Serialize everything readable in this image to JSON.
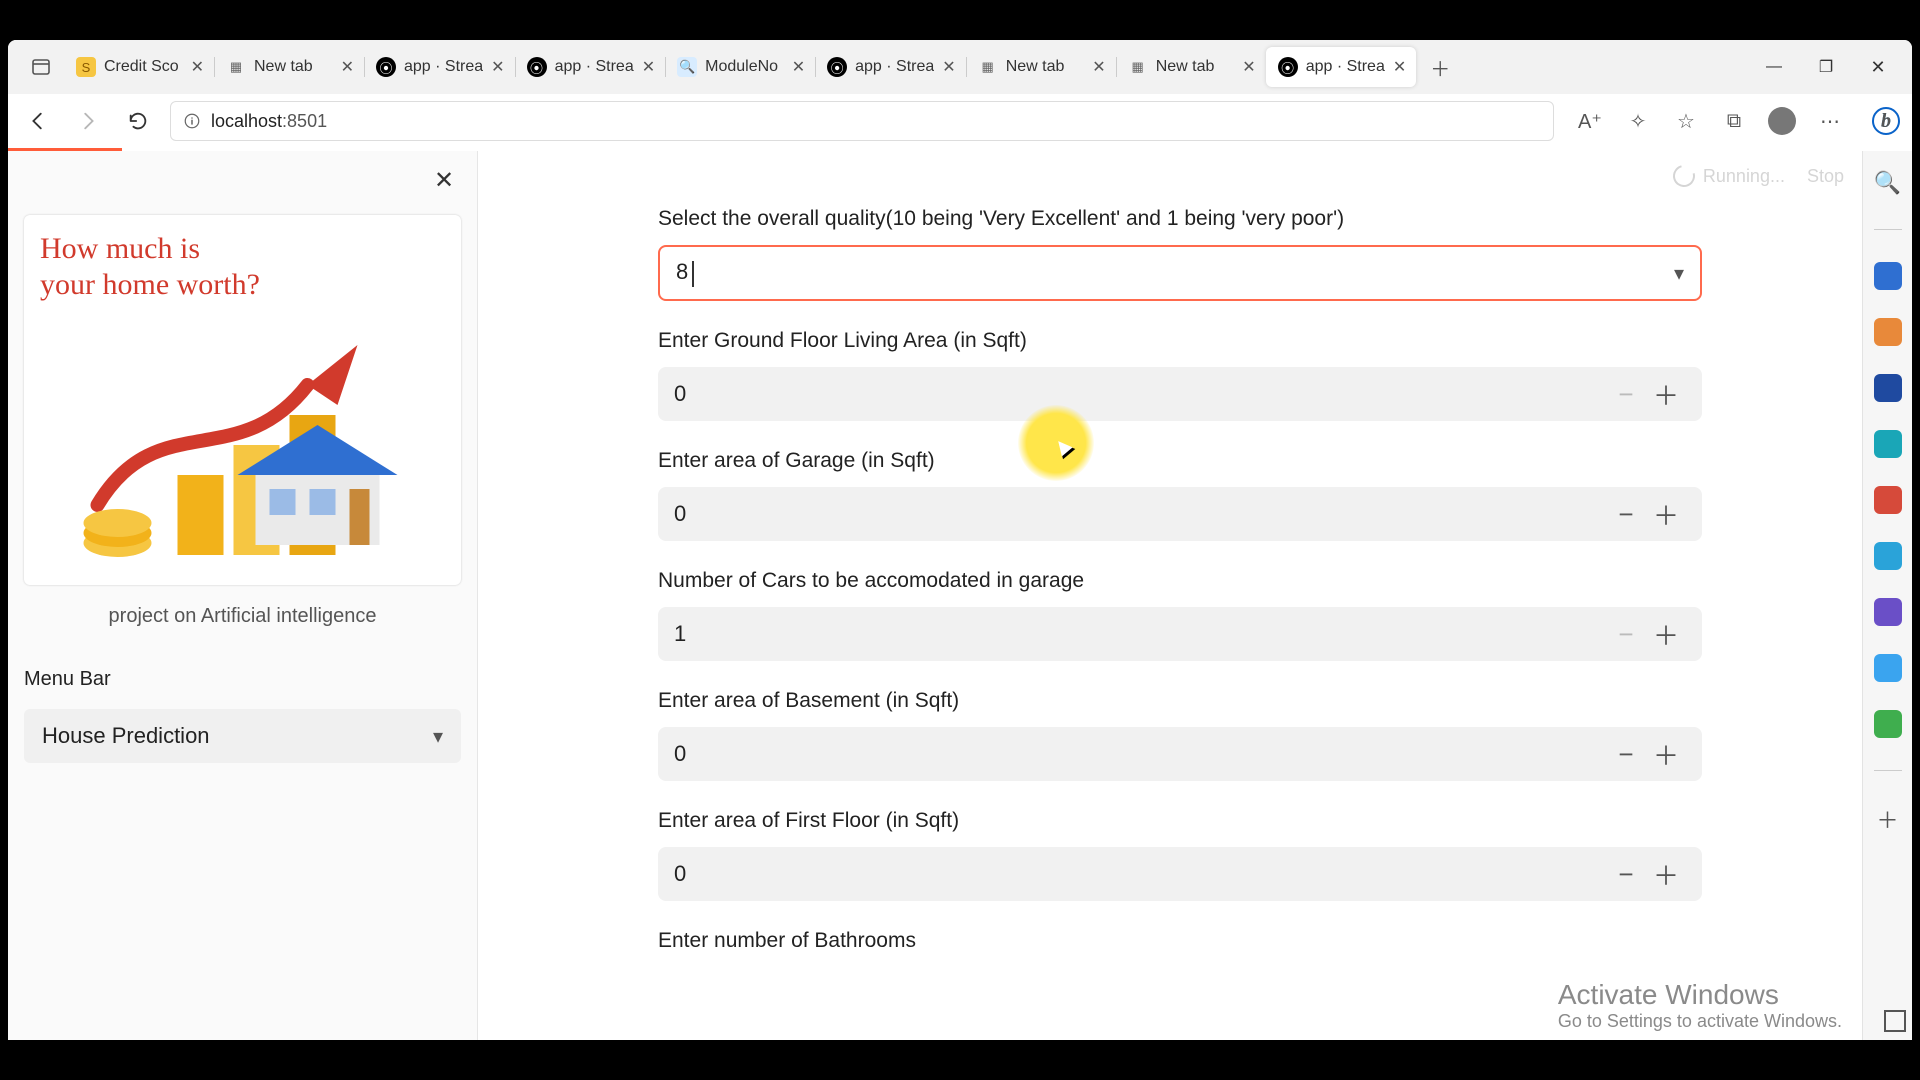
{
  "browser": {
    "tabs": [
      {
        "title": "Credit Sco",
        "favicon_bg": "#f6c642",
        "favicon_text": "S",
        "active": false
      },
      {
        "title": "New tab",
        "favicon_bg": "#e0e0e0",
        "favicon_text": "",
        "active": false,
        "newtab_icon": true
      },
      {
        "title": "app · Strea",
        "favicon_bg": "#000",
        "favicon_text": "⦿",
        "active": false
      },
      {
        "title": "app · Strea",
        "favicon_bg": "#000",
        "favicon_text": "⦿",
        "active": false
      },
      {
        "title": "ModuleNo",
        "favicon_bg": "#d8ecff",
        "favicon_text": "🔍",
        "active": false
      },
      {
        "title": "app · Strea",
        "favicon_bg": "#000",
        "favicon_text": "⦿",
        "active": false
      },
      {
        "title": "New tab",
        "favicon_bg": "#e0e0e0",
        "favicon_text": "",
        "active": false,
        "newtab_icon": true
      },
      {
        "title": "New tab",
        "favicon_bg": "#e0e0e0",
        "favicon_text": "",
        "active": false,
        "newtab_icon": true
      },
      {
        "title": "app · Strea",
        "favicon_bg": "#000",
        "favicon_text": "⦿",
        "active": true
      }
    ],
    "url_host": "localhost",
    "url_port": ":8501"
  },
  "sidebar": {
    "promo_line1": "How much is",
    "promo_line2": "your home worth?",
    "caption": "project on Artificial intelligence",
    "menu_label": "Menu Bar",
    "menu_selected": "House Prediction"
  },
  "top_controls": {
    "running_label": "Running...",
    "stop_label": "Stop"
  },
  "form": {
    "quality_label": "Select the overall quality(10 being 'Very Excellent' and 1 being 'very poor')",
    "quality_value": "8",
    "ground_label": "Enter Ground Floor Living Area (in Sqft)",
    "ground_value": "0",
    "garage_area_label": "Enter area of Garage (in Sqft)",
    "garage_area_value": "0",
    "cars_label": "Number of Cars to be accomodated in garage",
    "cars_value": "1",
    "basement_label": "Enter area of Basement (in Sqft)",
    "basement_value": "0",
    "first_floor_label": "Enter area of First Floor (in Sqft)",
    "first_floor_value": "0",
    "bathrooms_label": "Enter number of Bathrooms"
  },
  "watermark": {
    "line1": "Activate Windows",
    "line2": "Go to Settings to activate Windows."
  }
}
